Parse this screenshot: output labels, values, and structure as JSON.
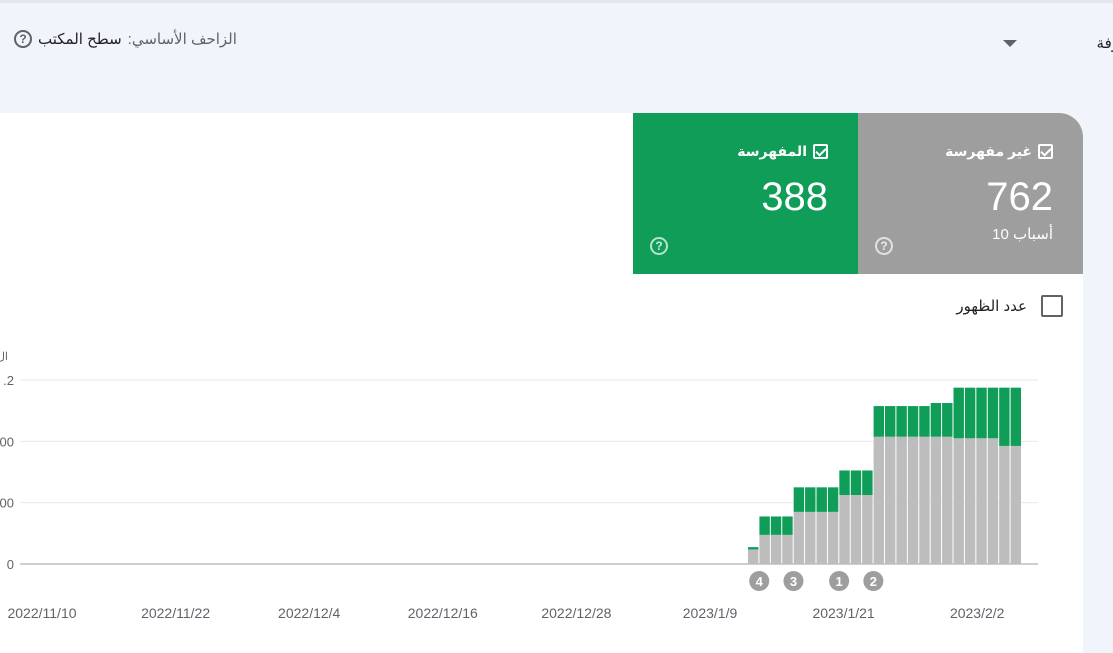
{
  "crawler": {
    "label": "الزاحف الأساسي:",
    "value": "سطح المكتب",
    "help_icon": "?"
  },
  "dropdown": {
    "label": "وفة"
  },
  "cards": {
    "not_indexed": {
      "title": "غير مفهرسة",
      "value": "762",
      "sub": "10 أسباب",
      "color": "#9e9e9e"
    },
    "indexed": {
      "title": "المفهرسة",
      "value": "388",
      "color": "#0f9d58"
    },
    "help_icon": "?"
  },
  "impressions": {
    "label": "عدد الظهور"
  },
  "chart_data": {
    "type": "bar",
    "stacked": true,
    "y_axis_title": "ال",
    "ylim": [
      0,
      1200
    ],
    "y_ticks": [
      0,
      400,
      800,
      1200
    ],
    "y_tick_labels": [
      "0",
      "00",
      "00",
      ".2"
    ],
    "x_tick_labels": [
      "2022/11/10",
      "2022/11/22",
      "2022/12/4",
      "2022/12/16",
      "2022/12/28",
      "2023/1/9",
      "2023/1/21",
      "2023/2/2"
    ],
    "series": [
      {
        "color": "#bdbdbd",
        "values": [
          95,
          190,
          190,
          190,
          340,
          340,
          340,
          340,
          450,
          450,
          450,
          830,
          830,
          830,
          830,
          830,
          830,
          830,
          820,
          820,
          820,
          820,
          770,
          770
        ]
      },
      {
        "color": "#0f9d58",
        "values": [
          15,
          120,
          120,
          120,
          160,
          160,
          160,
          160,
          160,
          160,
          160,
          200,
          200,
          200,
          200,
          200,
          220,
          220,
          330,
          330,
          330,
          330,
          380,
          380
        ]
      }
    ],
    "annotations": [
      {
        "label": "4",
        "bar_index": 0
      },
      {
        "label": "3",
        "bar_index": 3
      },
      {
        "label": "1",
        "bar_index": 7
      },
      {
        "label": "2",
        "bar_index": 10
      }
    ],
    "grid": true
  }
}
